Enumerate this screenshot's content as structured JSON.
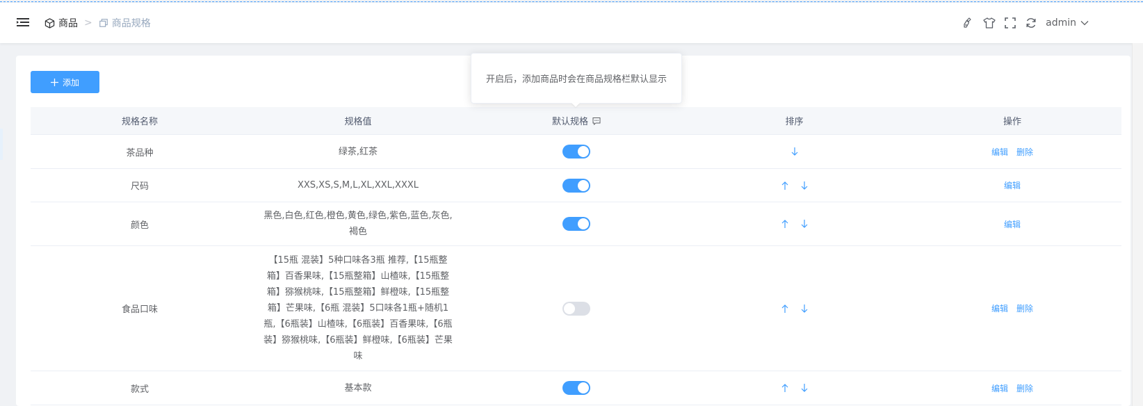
{
  "breadcrumb": {
    "root_label": "商品",
    "separator": ">",
    "current_label": "商品规格"
  },
  "header": {
    "user_name": "admin",
    "icons": [
      "cleaner-icon",
      "tshirt-icon",
      "fullscreen-icon",
      "refresh-icon"
    ]
  },
  "toolbar": {
    "add_label": "添加"
  },
  "tooltip": {
    "text": "开启后，添加商品时会在商品规格栏默认显示"
  },
  "table": {
    "columns": [
      "规格名称",
      "规格值",
      "默认规格",
      "排序",
      "操作"
    ],
    "rows": [
      {
        "name": "茶品种",
        "values": "绿茶,红茶",
        "default_on": true,
        "sort": [
          "down"
        ],
        "actions": [
          "编辑",
          "删除"
        ]
      },
      {
        "name": "尺码",
        "values": "XXS,XS,S,M,L,XL,XXL,XXXL",
        "default_on": true,
        "sort": [
          "up",
          "down"
        ],
        "actions": [
          "编辑"
        ]
      },
      {
        "name": "颜色",
        "values": "黑色,白色,红色,橙色,黄色,绿色,紫色,蓝色,灰色,褐色",
        "default_on": true,
        "sort": [
          "up",
          "down"
        ],
        "actions": [
          "编辑"
        ]
      },
      {
        "name": "食品口味",
        "values": "【15瓶 混装】5种口味各3瓶 推荐,【15瓶整箱】百香果味,【15瓶整箱】山楂味,【15瓶整箱】猕猴桃味,【15瓶整箱】鲜橙味,【15瓶整箱】芒果味,【6瓶 混装】5口味各1瓶+随机1瓶,【6瓶装】山楂味,【6瓶装】百香果味,【6瓶装】猕猴桃味,【6瓶装】鲜橙味,【6瓶装】芒果味",
        "default_on": false,
        "sort": [
          "up",
          "down"
        ],
        "actions": [
          "编辑",
          "删除"
        ]
      },
      {
        "name": "款式",
        "values": "基本款",
        "default_on": true,
        "sort": [
          "up",
          "down"
        ],
        "actions": [
          "编辑",
          "删除"
        ]
      }
    ]
  },
  "colors": {
    "primary": "#409eff",
    "switch_off": "#dcdfe6",
    "header_bg": "#f5f7fa"
  }
}
